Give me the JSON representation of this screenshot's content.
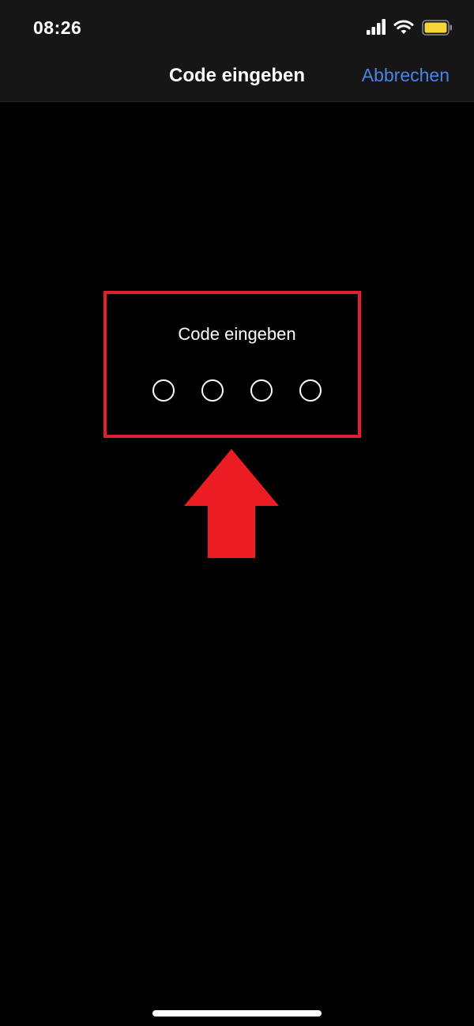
{
  "status_bar": {
    "time": "08:26",
    "icons": [
      "signal-icon",
      "wifi-icon",
      "battery-icon"
    ]
  },
  "nav_bar": {
    "title": "Code eingeben",
    "cancel_label": "Abbrechen"
  },
  "passcode": {
    "prompt": "Code eingeben",
    "digits_total": 4,
    "digits_entered": 0
  },
  "annotation": {
    "box_color": "#e0202e",
    "arrow_color": "#ec1c24",
    "arrow_direction": "up"
  },
  "colors": {
    "background": "#000000",
    "nav_background": "#161616",
    "accent": "#4a84e8",
    "text": "#ffffff"
  }
}
